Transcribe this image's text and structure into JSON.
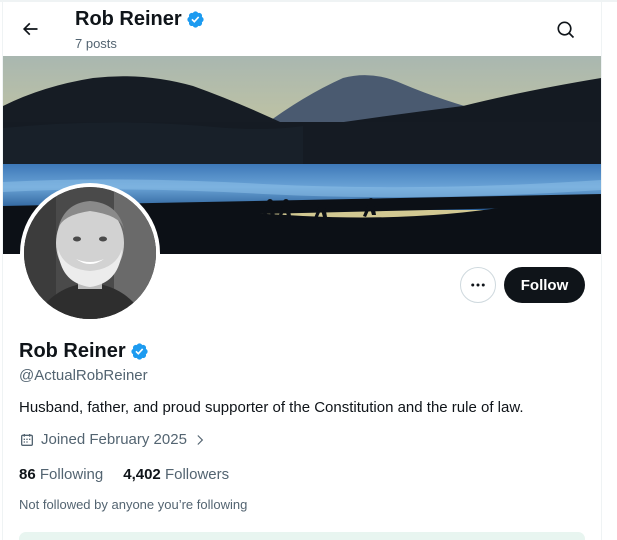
{
  "header": {
    "title": "Rob Reiner",
    "posts_count": "7 posts"
  },
  "icons": {
    "back": "arrow-left-icon",
    "search": "search-icon",
    "verified": "verified-badge-icon",
    "more": "more-horizontal-icon",
    "calendar": "calendar-icon",
    "chevron": "chevron-right-icon"
  },
  "profile": {
    "name": "Rob Reiner",
    "handle": "@ActualRobReiner",
    "bio": "Husband, father, and proud supporter of the Constitution and the rule of law.",
    "joined": "Joined February 2025",
    "following_count": "86",
    "following_label": "Following",
    "followers_count": "4,402",
    "followers_label": "Followers",
    "not_followed": "Not followed by anyone you’re following"
  },
  "actions": {
    "follow_label": "Follow"
  },
  "colors": {
    "verified": "#1d9bf0",
    "follow_bg": "#0f1419",
    "secondary_text": "#536471"
  }
}
